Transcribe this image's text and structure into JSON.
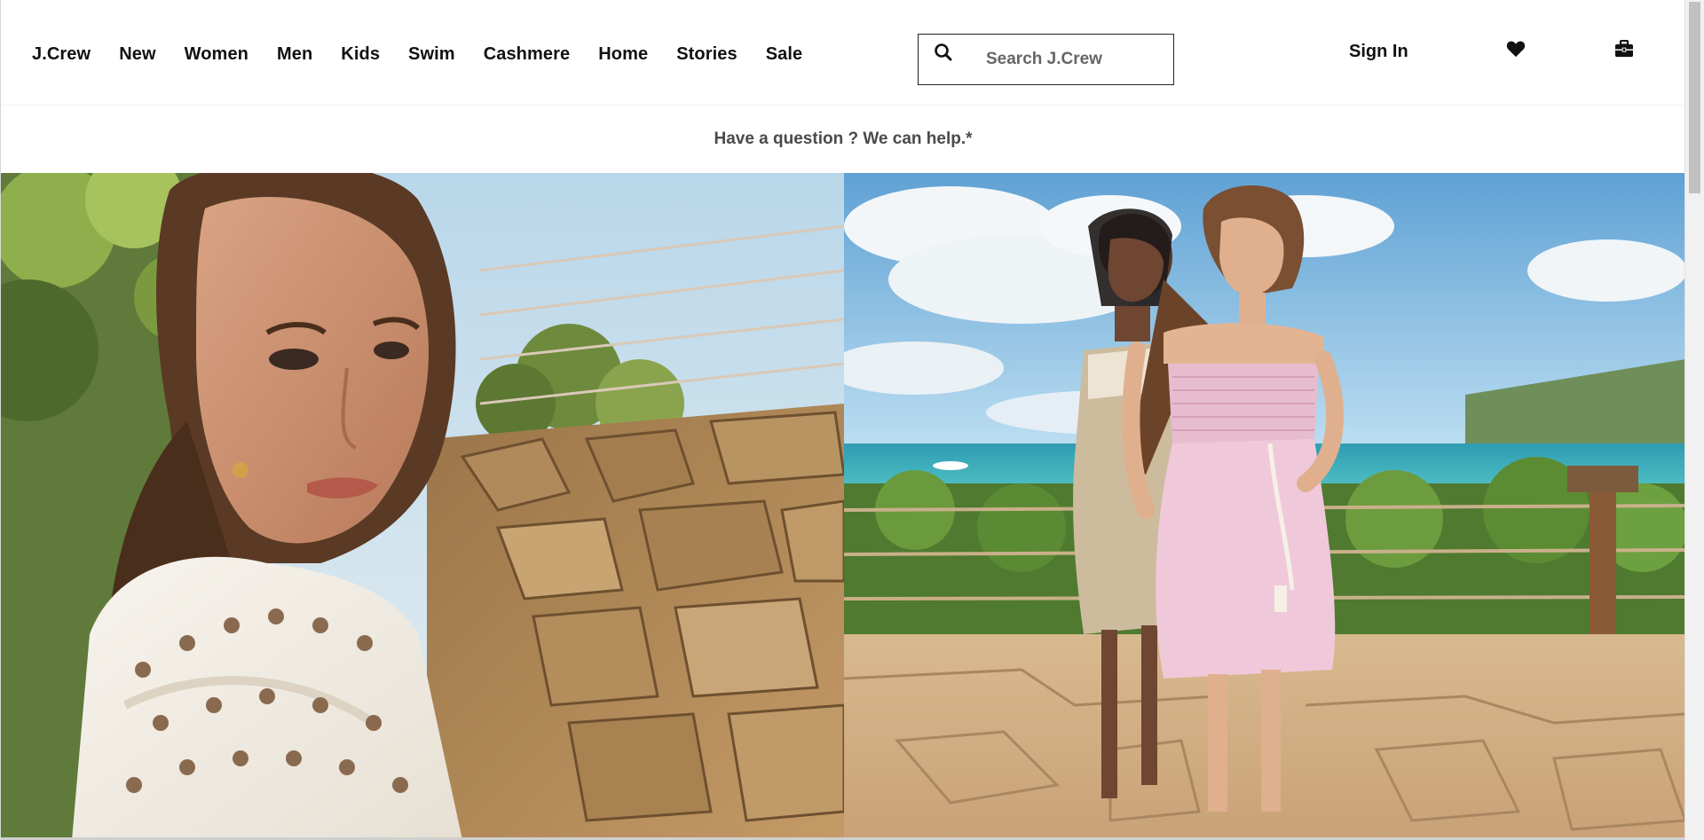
{
  "header": {
    "nav": [
      "J.Crew",
      "New",
      "Women",
      "Men",
      "Kids",
      "Swim",
      "Cashmere",
      "Home",
      "Stories",
      "Sale"
    ],
    "search_placeholder": "Search J.Crew",
    "sign_in": "Sign In",
    "icons": [
      "search-icon",
      "heart-icon",
      "shopping-bag-icon"
    ]
  },
  "promo": {
    "text": "Have a question ? We can help.*"
  },
  "colors": {
    "text": "#111111",
    "promo_text": "#4a4a4a",
    "border": "#222222"
  }
}
